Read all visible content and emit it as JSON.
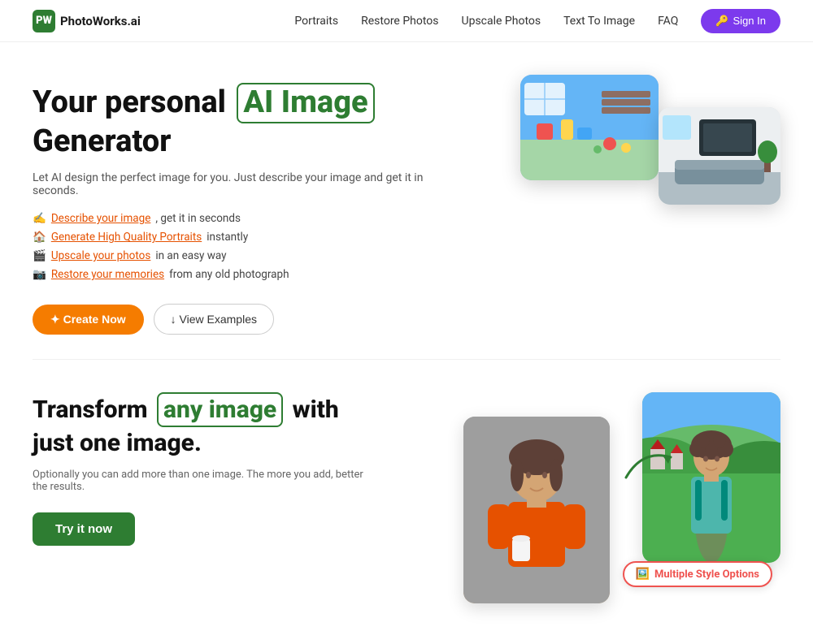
{
  "nav": {
    "logo_text": "PhotoWorks.ai",
    "logo_icon": "PW",
    "links": [
      {
        "label": "Portraits",
        "href": "#"
      },
      {
        "label": "Restore Photos",
        "href": "#"
      },
      {
        "label": "Upscale Photos",
        "href": "#"
      },
      {
        "label": "Text To Image",
        "href": "#"
      },
      {
        "label": "FAQ",
        "href": "#"
      }
    ],
    "signin_label": "Sign In"
  },
  "hero": {
    "title_prefix": "Your personal ",
    "title_highlight": "AI Image",
    "title_suffix": " Generator",
    "subtitle": "Let AI design the perfect image for you. Just describe your image and get it in seconds.",
    "features": [
      {
        "emoji": "✍️",
        "link_text": "Describe your image",
        "rest": ", get it in seconds"
      },
      {
        "emoji": "🏠",
        "link_text": "Generate High Quality Portraits",
        "rest": " instantly"
      },
      {
        "emoji": "🎬",
        "link_text": "Upscale your photos",
        "rest": " in an easy way"
      },
      {
        "emoji": "📷",
        "link_text": "Restore your memories",
        "rest": " from any old photograph"
      }
    ],
    "btn_create": "✦ Create Now",
    "btn_examples": "↓ View Examples"
  },
  "transform": {
    "title_prefix": "Transform ",
    "title_highlight": "any image",
    "title_suffix": " with just one image.",
    "subtitle": "Optionally you can add more than one image. The more you add, better the results.",
    "btn_label": "Try it now",
    "style_badge": "Multiple Style Options"
  }
}
